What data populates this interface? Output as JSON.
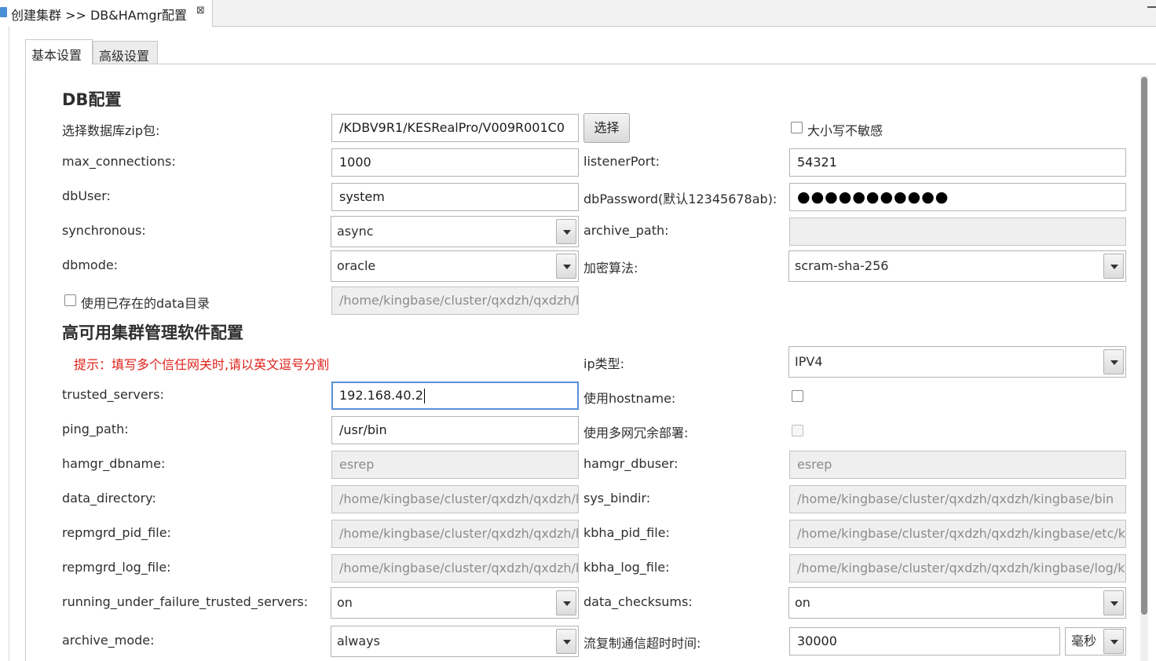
{
  "editor": {
    "tab_title": "创建集群 >> DB&HAmgr配置",
    "close_glyph": "⊠"
  },
  "tabs": {
    "basic": "基本设置",
    "advanced": "高级设置"
  },
  "db_section": {
    "title": "DB配置",
    "zip_label": "选择数据库zip包:",
    "zip_value": "/KDBV9R1/KESRealPro/V009R001C0",
    "choose_button": "选择",
    "case_insensitive_label": "大小写不敏感",
    "max_connections_label": "max_connections:",
    "max_connections_value": "1000",
    "listener_port_label": "listenerPort:",
    "listener_port_value": "54321",
    "db_user_label": "dbUser:",
    "db_user_value": "system",
    "db_password_label": "dbPassword(默认12345678ab):",
    "db_password_value": "●●●●●●●●●●●",
    "synchronous_label": "synchronous:",
    "synchronous_value": "async",
    "archive_path_label": "archive_path:",
    "archive_path_value": "",
    "dbmode_label": "dbmode:",
    "dbmode_value": "oracle",
    "encryption_label": "加密算法:",
    "encryption_value": "scram-sha-256",
    "use_existing_data_label": "使用已存在的data目录",
    "existing_data_path": "/home/kingbase/cluster/qxdzh/qxdzh/kingbase/data"
  },
  "ha_section": {
    "title": "高可用集群管理软件配置",
    "hint": "提示：填写多个信任网关时,请以英文逗号分割",
    "ip_type_label": "ip类型:",
    "ip_type_value": "IPV4",
    "trusted_servers_label": "trusted_servers:",
    "trusted_servers_value": "192.168.40.2",
    "use_hostname_label": "使用hostname:",
    "ping_path_label": "ping_path:",
    "ping_path_value": "/usr/bin",
    "multi_network_label": "使用多网冗余部署:",
    "hamgr_dbname_label": "hamgr_dbname:",
    "hamgr_dbname_value": "esrep",
    "hamgr_dbuser_label": "hamgr_dbuser:",
    "hamgr_dbuser_value": "esrep",
    "data_directory_label": "data_directory:",
    "data_directory_value": "/home/kingbase/cluster/qxdzh/qxdzh/kingbase/data",
    "sys_bindir_label": "sys_bindir:",
    "sys_bindir_value": "/home/kingbase/cluster/qxdzh/qxdzh/kingbase/bin",
    "repmgrd_pid_label": "repmgrd_pid_file:",
    "repmgrd_pid_value": "/home/kingbase/cluster/qxdzh/qxdzh/kingbase/etc/hamgrd.pid",
    "kbha_pid_label": "kbha_pid_file:",
    "kbha_pid_value": "/home/kingbase/cluster/qxdzh/qxdzh/kingbase/etc/kbha.pid",
    "repmgrd_log_label": "repmgrd_log_file:",
    "repmgrd_log_value": "/home/kingbase/cluster/qxdzh/qxdzh/kingbase/log/hamgr.log",
    "kbha_log_label": "kbha_log_file:",
    "kbha_log_value": "/home/kingbase/cluster/qxdzh/qxdzh/kingbase/log/kbha.log",
    "running_under_failure_label": "running_under_failure_trusted_servers:",
    "running_under_failure_value": "on",
    "data_checksums_label": "data_checksums:",
    "data_checksums_value": "on",
    "archive_mode_label": "archive_mode:",
    "archive_mode_value": "always",
    "replication_timeout_label": "流复制通信超时时间:",
    "replication_timeout_value": "30000",
    "replication_timeout_unit": "毫秒"
  }
}
